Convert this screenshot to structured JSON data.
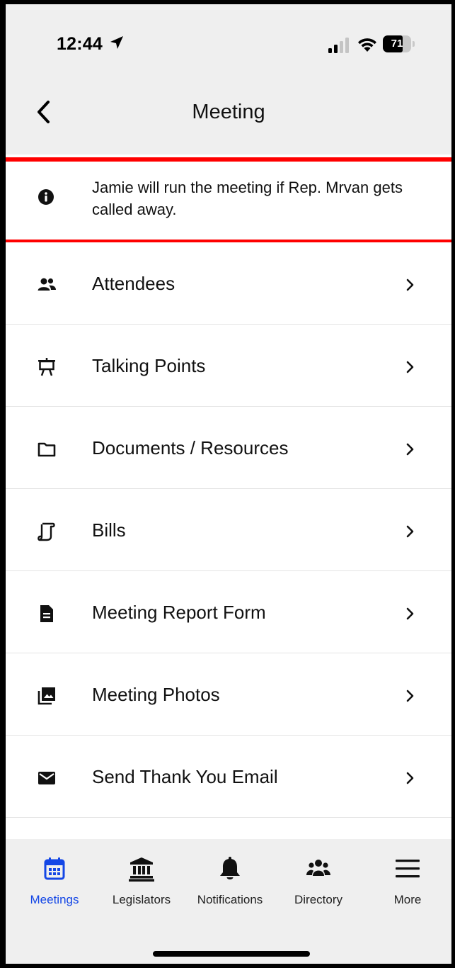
{
  "status": {
    "time": "12:44",
    "battery": "71",
    "battery_level": 0.71
  },
  "nav": {
    "title": "Meeting"
  },
  "note": {
    "text": "Jamie will run the meeting if Rep. Mrvan gets called away.",
    "icon": "info-icon"
  },
  "menu": [
    {
      "label": "Attendees",
      "icon": "people-icon"
    },
    {
      "label": "Talking Points",
      "icon": "presentation-easel-icon"
    },
    {
      "label": "Documents / Resources",
      "icon": "folder-icon"
    },
    {
      "label": "Bills",
      "icon": "scroll-icon"
    },
    {
      "label": "Meeting Report Form",
      "icon": "document-icon"
    },
    {
      "label": "Meeting Photos",
      "icon": "photos-icon"
    },
    {
      "label": "Send Thank You Email",
      "icon": "envelope-icon"
    }
  ],
  "tabs": [
    {
      "label": "Meetings",
      "icon": "calendar-icon",
      "active": true
    },
    {
      "label": "Legislators",
      "icon": "capitol-building-icon",
      "active": false
    },
    {
      "label": "Notifications",
      "icon": "bell-icon",
      "active": false
    },
    {
      "label": "Directory",
      "icon": "group-icon",
      "active": false
    },
    {
      "label": "More",
      "icon": "hamburger-menu-icon",
      "active": false
    }
  ],
  "colors": {
    "accent": "#1447e6",
    "highlight_outline": "#ff0000",
    "bar_background": "#efefef"
  }
}
